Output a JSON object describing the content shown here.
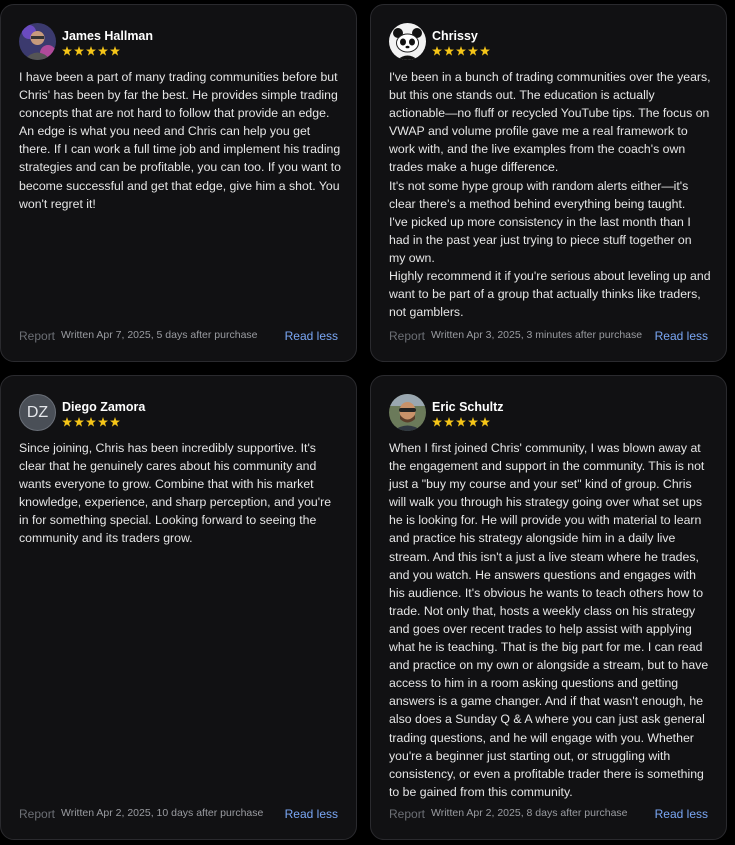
{
  "reviews": [
    {
      "name": "James Hallman",
      "avatar_icon": "user-photo-icon",
      "rating": 5,
      "text": "I have been a part of many trading communities before but Chris' has been by far the best. He provides simple trading concepts that are not hard to follow that provide an edge. An edge is what you need and Chris can help you get there. If I can work a full time job and implement his trading strategies and can be profitable, you can too. If you want to become successful and get that edge, give him a shot. You won't regret it!",
      "report_label": "Report",
      "written": "Written Apr 7, 2025, 5 days after purchase",
      "read_less_label": "Read less"
    },
    {
      "name": "Chrissy",
      "avatar_icon": "panda-avatar-icon",
      "rating": 5,
      "text": "I've been in a bunch of trading communities over the years, but this one stands out. The education is actually actionable—no fluff or recycled YouTube tips. The focus on VWAP and volume profile gave me a real framework to work with, and the live examples from the coach's own trades make a huge difference.\nIt's not some hype group with random alerts either—it's clear there's a method behind everything being taught.\nI've picked up more consistency in the last month than I had in the past year just trying to piece stuff together on my own.\nHighly recommend it if you're serious about leveling up and want to be part of a group that actually thinks like traders, not gamblers.",
      "report_label": "Report",
      "written": "Written Apr 3, 2025, 3 minutes after purchase",
      "read_less_label": "Read less"
    },
    {
      "name": "Diego Zamora",
      "avatar_initials": "DZ",
      "rating": 5,
      "text": "Since joining, Chris has been incredibly supportive. It's clear that he genuinely cares about his community and wants everyone to grow. Combine that with his market knowledge, experience, and sharp perception, and you're in for something special. Looking forward to seeing the community and its traders grow.",
      "report_label": "Report",
      "written": "Written Apr 2, 2025, 10 days after purchase",
      "read_less_label": "Read less"
    },
    {
      "name": "Eric Schultz",
      "avatar_icon": "user-photo-icon",
      "rating": 5,
      "text": "When I first joined Chris' community, I was blown away at the engagement and support in the community. This is not just a \"buy my course and your set\" kind of group. Chris will walk you through his strategy going over what set ups he is looking for. He will provide you with material to learn and practice his strategy alongside him in a daily live stream. And this isn't a just a live steam where he trades, and you watch. He answers questions and engages with his audience. It's obvious he wants to teach others how to trade. Not only that, hosts a weekly class on his strategy and goes over recent trades to help assist with applying what he is teaching. That is the big part for me. I can read and practice on my own or alongside a stream, but to have access to him in a room asking questions and getting answers is a game changer. And if that wasn't enough, he also does a Sunday Q & A where you can just ask general trading questions, and he will engage with you. Whether you're a beginner just starting out, or struggling with consistency, or even a profitable trader there is something to be gained from this community.",
      "report_label": "Report",
      "written": "Written Apr 2, 2025, 8 days after purchase",
      "read_less_label": "Read less"
    }
  ],
  "colors": {
    "background": "#000000",
    "card": "#111113",
    "star": "#f5c518",
    "link": "#7aa7f5"
  }
}
